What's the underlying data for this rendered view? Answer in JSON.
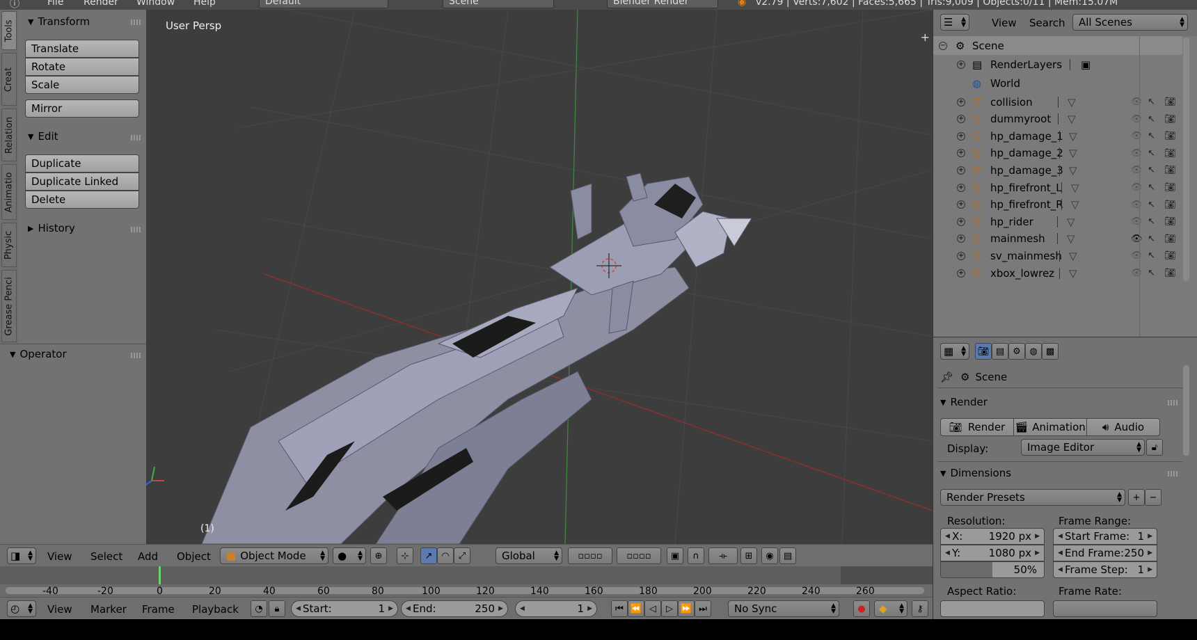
{
  "topbar": {
    "menu": [
      "File",
      "Render",
      "Window",
      "Help"
    ],
    "layout": "Default",
    "scene": "Scene",
    "engine": "Blender Render",
    "stats": "v2.79 | Verts:7,602 | Faces:5,665 | Tris:9,009 | Objects:0/11 | Mem:15.07M"
  },
  "tool_tabs": [
    "Tools",
    "Creat",
    "Relation",
    "Animatio",
    "Physic",
    "Grease Penci"
  ],
  "tool_shelf": {
    "transform": {
      "title": "Transform",
      "buttons": [
        "Translate",
        "Rotate",
        "Scale"
      ],
      "mirror": "Mirror"
    },
    "edit": {
      "title": "Edit",
      "buttons": [
        "Duplicate",
        "Duplicate Linked",
        "Delete"
      ]
    },
    "history": "History",
    "operator": "Operator"
  },
  "viewport": {
    "label": "User Persp",
    "frame": "(1)"
  },
  "view3d_header": {
    "menus": [
      "View",
      "Select",
      "Add",
      "Object"
    ],
    "mode": "Object Mode",
    "orientation": "Global"
  },
  "timeline": {
    "ticks": [
      "-40",
      "-20",
      "0",
      "20",
      "40",
      "60",
      "80",
      "100",
      "120",
      "140",
      "160",
      "180",
      "200",
      "220",
      "240",
      "260"
    ],
    "menus": [
      "View",
      "Marker",
      "Frame",
      "Playback"
    ],
    "start_label": "Start:",
    "start": "1",
    "end_label": "End:",
    "end": "250",
    "current": "1",
    "sync": "No Sync"
  },
  "outliner": {
    "menus": [
      "View",
      "Search"
    ],
    "filter": "All Scenes",
    "scene": "Scene",
    "render_layers": "RenderLayers",
    "world": "World",
    "objects": [
      "collision",
      "dummyroot",
      "hp_damage_1",
      "hp_damage_2",
      "hp_damage_3",
      "hp_firefront_L",
      "hp_firefront_R",
      "hp_rider",
      "mainmesh",
      "sv_mainmesh",
      "xbox_lowrez"
    ]
  },
  "properties": {
    "context": "Scene",
    "render_panel": "Render",
    "render_buttons": [
      "Render",
      "Animation",
      "Audio"
    ],
    "display_label": "Display:",
    "display_value": "Image Editor",
    "dimensions_panel": "Dimensions",
    "presets": "Render Presets",
    "resolution_label": "Resolution:",
    "res_x_label": "X:",
    "res_x": "1920 px",
    "res_y_label": "Y:",
    "res_y": "1080 px",
    "res_pct": "50%",
    "res_pct_value": 0.5,
    "frame_range_label": "Frame Range:",
    "start_frame_label": "Start Frame:",
    "start_frame": "1",
    "end_frame_label": "End Frame:",
    "end_frame": "250",
    "frame_step_label": "Frame Step:",
    "frame_step": "1",
    "aspect_label": "Aspect Ratio:",
    "frame_rate_label": "Frame Rate:"
  },
  "colors": {
    "viewport_bg": "#3d3d3d",
    "panel_bg": "#727272",
    "object_icon": "#c86400",
    "x_axis": "#9c2b2b",
    "y_axis": "#3e8c3e"
  }
}
